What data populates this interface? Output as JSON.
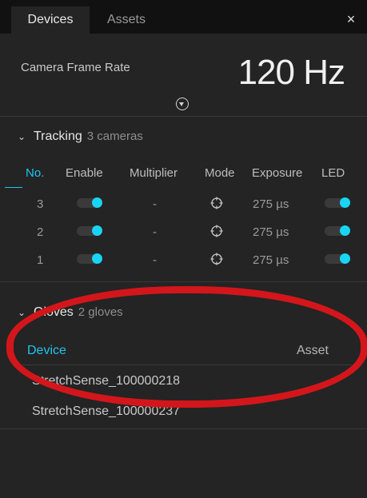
{
  "tabs": {
    "devices": "Devices",
    "assets": "Assets"
  },
  "close_label": "×",
  "camera_frame_rate": {
    "label": "Camera Frame Rate",
    "value": "120 Hz"
  },
  "tracking": {
    "title": "Tracking",
    "subtitle": "3 cameras",
    "columns": {
      "no": "No.",
      "enable": "Enable",
      "multiplier": "Multiplier",
      "mode": "Mode",
      "exposure": "Exposure",
      "led": "LED"
    },
    "rows": [
      {
        "no": "3",
        "enabled": true,
        "multiplier": "-",
        "mode_icon": "crosshair-icon",
        "exposure": "275 µs",
        "led": true
      },
      {
        "no": "2",
        "enabled": true,
        "multiplier": "-",
        "mode_icon": "crosshair-icon",
        "exposure": "275 µs",
        "led": true
      },
      {
        "no": "1",
        "enabled": true,
        "multiplier": "-",
        "mode_icon": "crosshair-icon",
        "exposure": "275 µs",
        "led": true
      }
    ]
  },
  "gloves": {
    "title": "Gloves",
    "subtitle": "2 gloves",
    "columns": {
      "device": "Device",
      "asset": "Asset"
    },
    "items": [
      {
        "device": "StretchSense_100000218"
      },
      {
        "device": "StretchSense_100000237"
      }
    ]
  },
  "colors": {
    "accent": "#1ec4ef",
    "highlight": "#d3161b",
    "panel": "#242424"
  }
}
